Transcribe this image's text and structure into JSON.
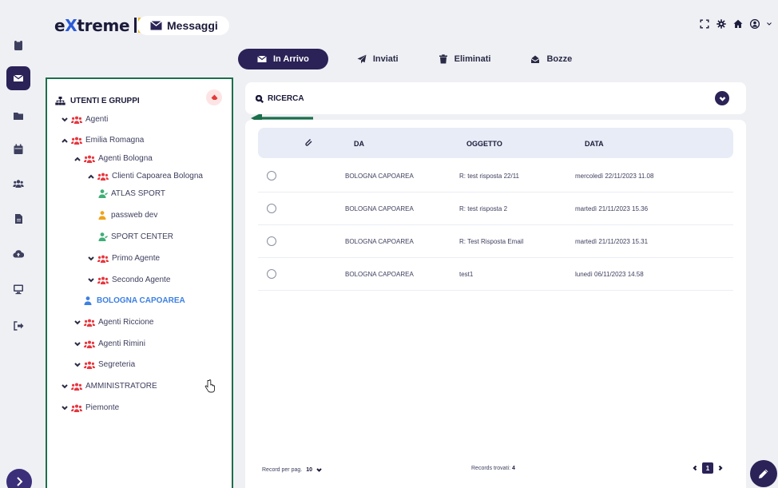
{
  "header": {
    "logo_e": "e",
    "logo_x": "X",
    "logo_rest": "treme",
    "page_label": "Messaggi",
    "icons": [
      "fullscreen-icon",
      "settings-icon",
      "home-icon",
      "user-icon"
    ]
  },
  "rail": {
    "items": [
      "clipboard-icon",
      "envelope-icon",
      "folder-icon",
      "calendar-icon",
      "users-icon",
      "document-icon",
      "cloud-upload-icon",
      "monitor-icon",
      "logout-icon"
    ],
    "active": "envelope-icon"
  },
  "tabs": [
    {
      "label": "In Arrivo",
      "icon": "envelope-icon",
      "active": true
    },
    {
      "label": "Inviati",
      "icon": "paper-plane-icon",
      "active": false
    },
    {
      "label": "Eliminati",
      "icon": "trash-icon",
      "active": false
    },
    {
      "label": "Bozze",
      "icon": "inbox-icon",
      "active": false
    }
  ],
  "tree": {
    "title": "UTENTI E GRUPPI",
    "nodes": [
      {
        "label": "Agenti",
        "type": "group",
        "expanded": false
      },
      {
        "label": "Emilia Romagna",
        "type": "group",
        "expanded": true
      },
      {
        "label": "Agenti Bologna",
        "type": "group",
        "expanded": true
      },
      {
        "label": "Clienti Capoarea Bologna",
        "type": "group",
        "expanded": true
      },
      {
        "label": "ATLAS SPORT",
        "type": "user-green"
      },
      {
        "label": "passweb dev",
        "type": "user-orange"
      },
      {
        "label": "SPORT CENTER",
        "type": "user-green"
      },
      {
        "label": "Primo Agente",
        "type": "group",
        "expanded": false
      },
      {
        "label": "Secondo Agente",
        "type": "group",
        "expanded": false
      },
      {
        "label": "BOLOGNA CAPOAREA",
        "type": "user-blue",
        "selected": true
      },
      {
        "label": "Agenti Riccione",
        "type": "group",
        "expanded": false
      },
      {
        "label": "Agenti Rimini",
        "type": "group",
        "expanded": false
      },
      {
        "label": "Segreteria",
        "type": "group",
        "expanded": false
      },
      {
        "label": "AMMINISTRATORE",
        "type": "group",
        "expanded": false
      },
      {
        "label": "Piemonte",
        "type": "group",
        "expanded": false
      }
    ]
  },
  "search": {
    "label": "RICERCA"
  },
  "table": {
    "columns": {
      "from": "DA",
      "subject": "OGGETTO",
      "date": "DATA"
    },
    "rows": [
      {
        "from": "BOLOGNA CAPOAREA",
        "subject": "R: test risposta 22/11",
        "date": "mercoledì 22/11/2023 11.08"
      },
      {
        "from": "BOLOGNA CAPOAREA",
        "subject": "R: test risposta 2",
        "date": "martedì 21/11/2023 15.36"
      },
      {
        "from": "BOLOGNA CAPOAREA",
        "subject": "R: Test Risposta Email",
        "date": "martedì 21/11/2023 15.31"
      },
      {
        "from": "BOLOGNA CAPOAREA",
        "subject": "test1",
        "date": "lunedì 06/11/2023 14.58"
      }
    ]
  },
  "footer": {
    "records_per_page_label": "Record per pag.",
    "records_per_page": "10",
    "records_found_label": "Records trovati:",
    "records_found": "4",
    "current_page": "1"
  },
  "colors": {
    "primary": "#2b2257",
    "group": "#e8363e",
    "highlight_border": "#1c6f4b",
    "selected_user": "#3d80e3"
  }
}
